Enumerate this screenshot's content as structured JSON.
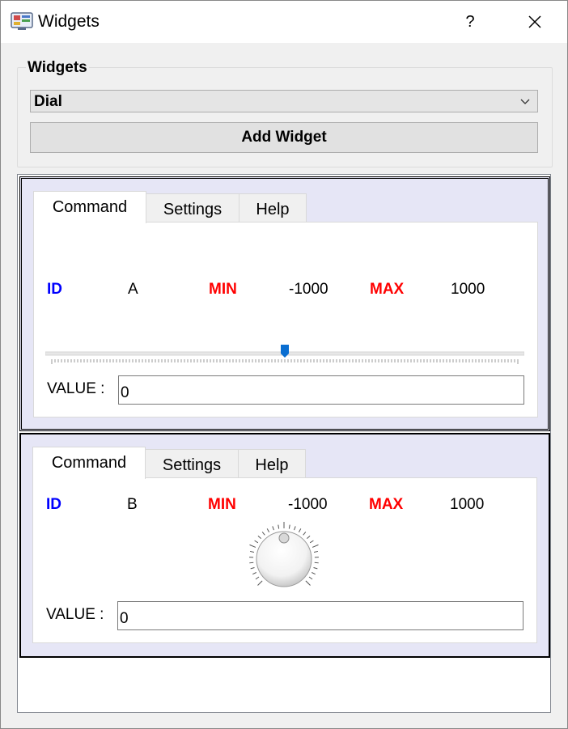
{
  "window": {
    "title": "Widgets",
    "help_glyph": "?"
  },
  "group": {
    "title": "Widgets",
    "combo_value": "Dial",
    "add_button_label": "Add Widget"
  },
  "panels": [
    {
      "tabs": [
        "Command",
        "Settings",
        "Help"
      ],
      "active_tab": "Command",
      "id_label": "ID",
      "id_value": "A",
      "min_label": "MIN",
      "min_value": "-1000",
      "max_label": "MAX",
      "max_value": "1000",
      "widget": "slider",
      "slider_value": 0,
      "value_label": "VALUE :",
      "value": "0"
    },
    {
      "tabs": [
        "Command",
        "Settings",
        "Help"
      ],
      "active_tab": "Command",
      "id_label": "ID",
      "id_value": "B",
      "min_label": "MIN",
      "min_value": "-1000",
      "max_label": "MAX",
      "max_value": "1000",
      "widget": "dial",
      "dial_value": 0,
      "value_label": "VALUE :",
      "value": "0"
    }
  ],
  "colors": {
    "id": "#0000ff",
    "minmax": "#ff0000",
    "panel_bg": "#e6e6f6",
    "slider_handle": "#0a6ed1"
  }
}
